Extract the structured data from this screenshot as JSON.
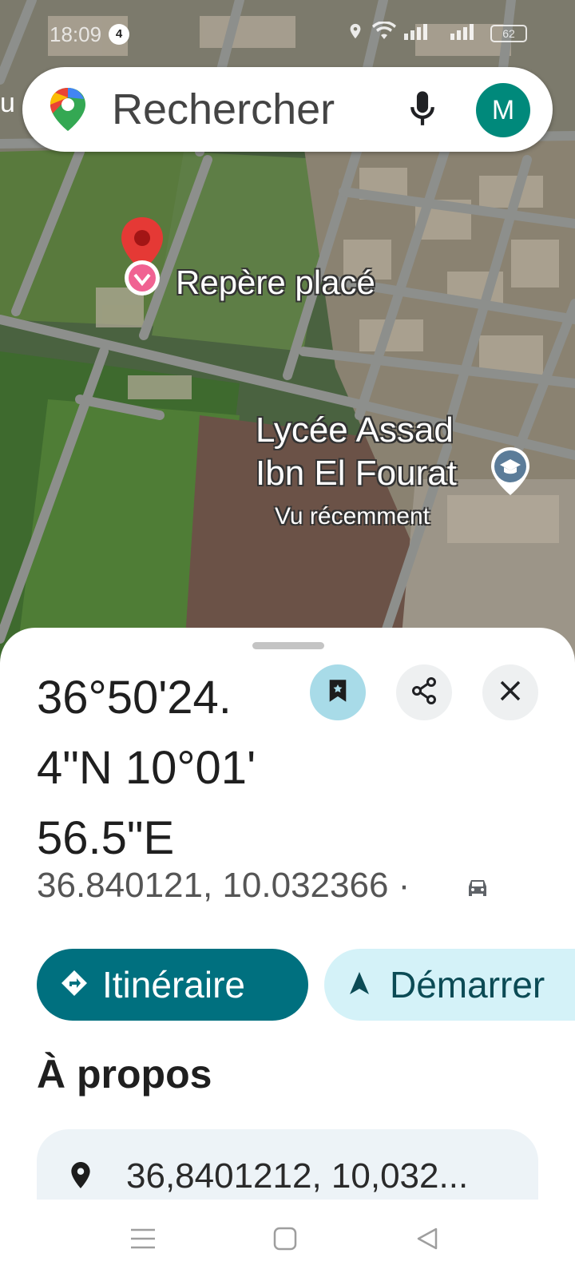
{
  "status_bar": {
    "time": "18:09",
    "notification_count": "4",
    "battery": "62"
  },
  "search": {
    "placeholder": "Rechercher",
    "avatar_letter": "M",
    "left_edge_text": "u"
  },
  "map": {
    "dropped_pin_label": "Repère placé",
    "poi": {
      "name_line1": "Lycée Assad",
      "name_line2": "Ibn El Fourat",
      "subtitle": "Vu récemment",
      "icon": "school-icon"
    }
  },
  "place": {
    "title_line1": "36°50'24.",
    "title_line2": "4\"N 10°01'",
    "title_line3": "56.5\"E",
    "decimal_coords": "36.840121, 10.032366 ·",
    "actions": {
      "directions": "Itinéraire",
      "start": "Démarrer"
    },
    "about_heading": "À propos",
    "about_coords": "36,8401212, 10,032..."
  },
  "colors": {
    "primary_button": "#00707f",
    "secondary_button": "#d4f2f8",
    "save_button": "#a8dbe8",
    "avatar": "#00897b",
    "pin": "#e53935"
  }
}
